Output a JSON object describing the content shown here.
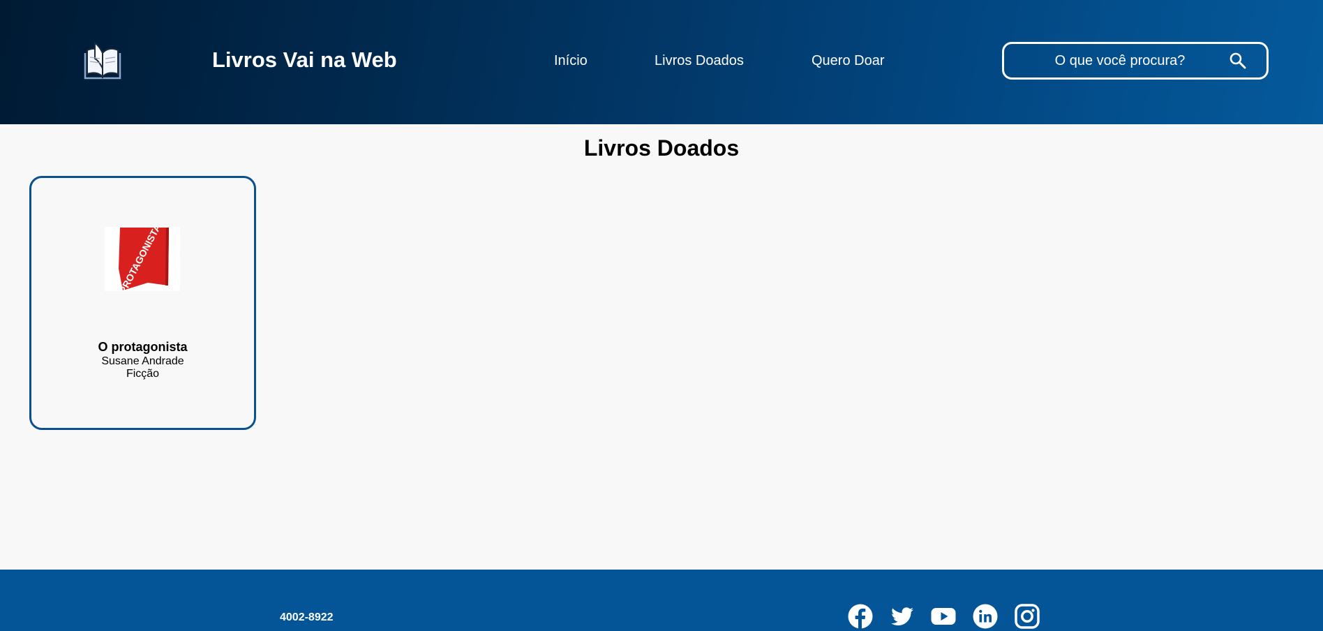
{
  "header": {
    "brand": "Livros Vai na Web",
    "nav": {
      "inicio": "Início",
      "doados": "Livros Doados",
      "doar": "Quero Doar"
    },
    "search": {
      "placeholder": "O que você procura?"
    }
  },
  "main": {
    "title": "Livros Doados",
    "books": [
      {
        "title": "O protagonista",
        "author": "Susane Andrade",
        "genre": "Ficção",
        "cover_text": "PROTAGONISTA"
      }
    ]
  },
  "footer": {
    "phone": "4002-8922",
    "social_icons": [
      "facebook-icon",
      "twitter-icon",
      "youtube-icon",
      "linkedin-icon",
      "instagram-icon"
    ]
  },
  "colors": {
    "header_dark": "#001a33",
    "header_light": "#045a9c",
    "footer": "#045597",
    "card_border": "#0a4f8f",
    "cover_red": "#d8211f"
  }
}
